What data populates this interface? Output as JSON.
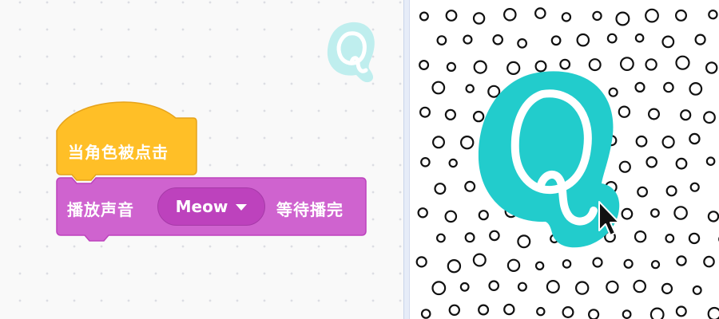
{
  "code_area": {
    "hat_block": {
      "label": "当角色被点击",
      "color": "#FFBF27"
    },
    "sound_block": {
      "label_left": "播放声音",
      "sound_value": "Meow",
      "label_right": "等待播完",
      "color": "#CF63CF",
      "dropdown_icon": "caret-down-icon"
    },
    "sprite_thumbnail": {
      "letter": "Q",
      "color": "#2BCFD0"
    }
  },
  "stage": {
    "backdrop": "polka-dots",
    "sprite": {
      "letter": "Q",
      "color": "#22CCCC"
    },
    "cursor": "mouse-pointer-icon"
  }
}
